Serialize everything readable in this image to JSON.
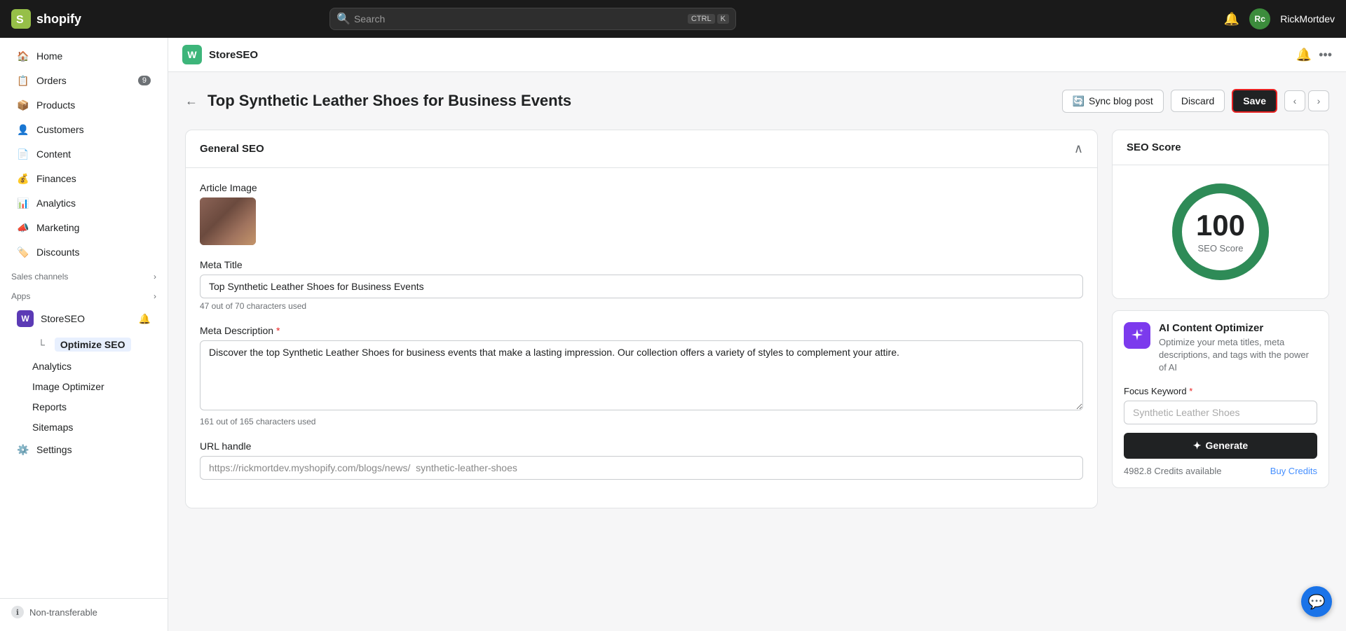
{
  "topbar": {
    "logo_text": "shopify",
    "search_placeholder": "Search",
    "kbd1": "CTRL",
    "kbd2": "K",
    "avatar_initials": "Rc",
    "username": "RickMortdev"
  },
  "sidebar": {
    "nav_items": [
      {
        "id": "home",
        "label": "Home",
        "icon": "home"
      },
      {
        "id": "orders",
        "label": "Orders",
        "icon": "orders",
        "badge": "9"
      },
      {
        "id": "products",
        "label": "Products",
        "icon": "products"
      },
      {
        "id": "customers",
        "label": "Customers",
        "icon": "customers"
      },
      {
        "id": "content",
        "label": "Content",
        "icon": "content"
      },
      {
        "id": "finances",
        "label": "Finances",
        "icon": "finances"
      },
      {
        "id": "analytics",
        "label": "Analytics",
        "icon": "analytics"
      },
      {
        "id": "marketing",
        "label": "Marketing",
        "icon": "marketing"
      },
      {
        "id": "discounts",
        "label": "Discounts",
        "icon": "discounts"
      }
    ],
    "sales_channels_label": "Sales channels",
    "apps_label": "Apps",
    "storeseo_label": "StoreSEO",
    "optimize_seo_label": "Optimize SEO",
    "sub_items": [
      {
        "id": "analytics",
        "label": "Analytics"
      },
      {
        "id": "image-optimizer",
        "label": "Image Optimizer"
      },
      {
        "id": "reports",
        "label": "Reports"
      },
      {
        "id": "sitemaps",
        "label": "Sitemaps"
      }
    ],
    "settings_label": "Settings",
    "non_transferable_label": "Non-transferable"
  },
  "plugin_bar": {
    "plugin_name": "StoreSEO"
  },
  "page": {
    "title": "Top Synthetic Leather Shoes for Business Events",
    "sync_label": "Sync blog post",
    "discard_label": "Discard",
    "save_label": "Save"
  },
  "general_seo": {
    "section_title": "General SEO",
    "article_image_label": "Article Image",
    "meta_title_label": "Meta Title",
    "meta_title_value": "Top Synthetic Leather Shoes for Business Events",
    "meta_title_char_count": "47 out of 70 characters used",
    "meta_description_label": "Meta Description",
    "meta_description_value": "Discover the top Synthetic Leather Shoes for business events that make a lasting impression. Our collection offers a variety of styles to complement your attire.",
    "meta_description_char_count": "161 out of 165 characters used",
    "url_handle_label": "URL handle",
    "url_handle_value": "https://rickmortdev.myshopify.com/blogs/news/  synthetic-leather-shoes"
  },
  "seo_score": {
    "title": "SEO Score",
    "score": "100",
    "score_label": "SEO Score",
    "circle_bg": "#e0e0e0",
    "circle_fill": "#2e8b57",
    "circle_size": 150,
    "circle_stroke": 14,
    "circumference": 408
  },
  "ai_optimizer": {
    "title": "AI Content Optimizer",
    "description": "Optimize your meta titles, meta descriptions, and tags with the power of AI",
    "focus_keyword_label": "Focus Keyword",
    "focus_keyword_placeholder": "Synthetic Leather Shoes",
    "generate_label": "Generate",
    "credits_text": "4982.8 Credits available",
    "buy_credits_label": "Buy Credits"
  },
  "bottom_product": {
    "name": "Synthetic Leather Shoes"
  },
  "chat": {
    "icon": "💬"
  }
}
